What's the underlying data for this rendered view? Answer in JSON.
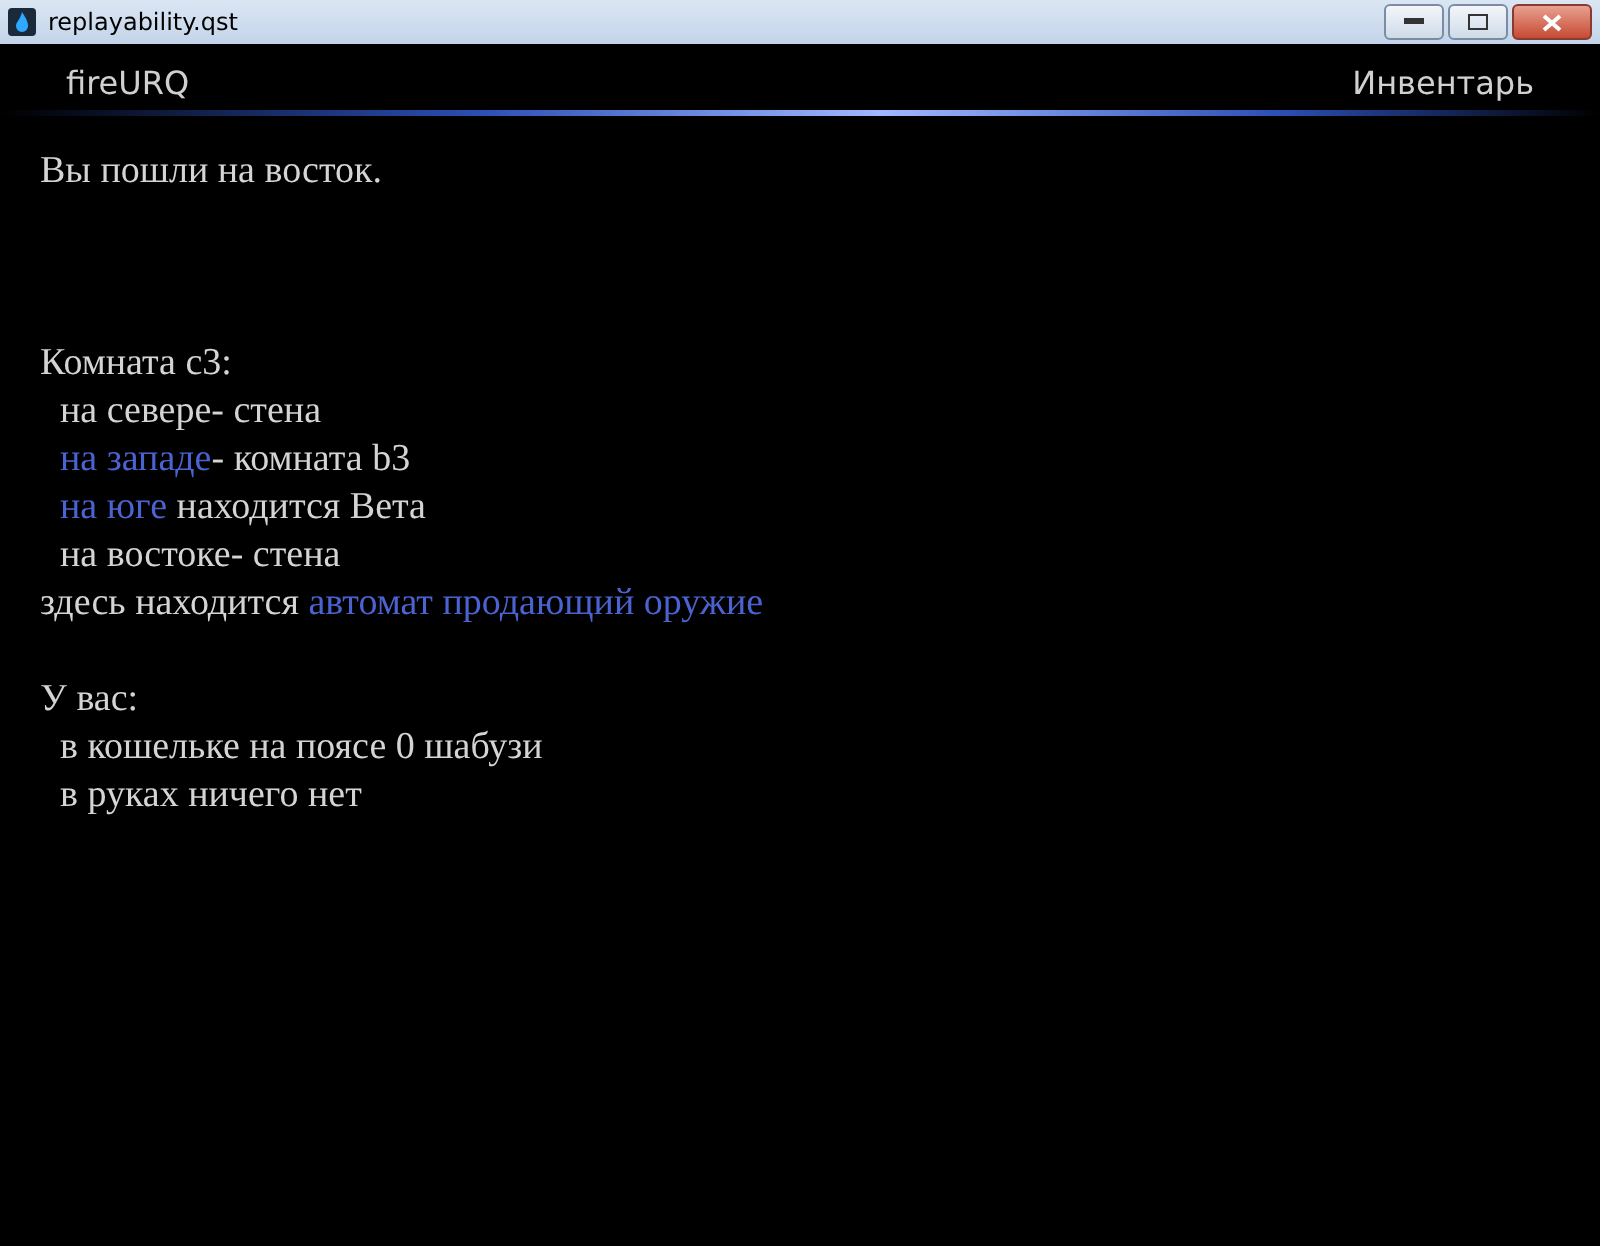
{
  "window": {
    "title": "replayability.qst"
  },
  "header": {
    "app_name": "fireURQ",
    "inventory": "Инвентарь"
  },
  "lines": [
    {
      "kind": "text",
      "indented": false,
      "parts": [
        {
          "kind": "text",
          "text": "Вы пошли на восток."
        }
      ]
    },
    {
      "kind": "blank"
    },
    {
      "kind": "blank"
    },
    {
      "kind": "blank"
    },
    {
      "kind": "text",
      "indented": false,
      "parts": [
        {
          "kind": "text",
          "text": "Комната c3:"
        }
      ]
    },
    {
      "kind": "text",
      "indented": true,
      "parts": [
        {
          "kind": "text",
          "text": "на севере- стена"
        }
      ]
    },
    {
      "kind": "text",
      "indented": true,
      "parts": [
        {
          "kind": "link",
          "text": "на западе"
        },
        {
          "kind": "text",
          "text": "- комната b3"
        }
      ]
    },
    {
      "kind": "text",
      "indented": true,
      "parts": [
        {
          "kind": "link",
          "text": "на юге"
        },
        {
          "kind": "text",
          "text": " находится Вета"
        }
      ]
    },
    {
      "kind": "text",
      "indented": true,
      "parts": [
        {
          "kind": "text",
          "text": "на востоке- стена"
        }
      ]
    },
    {
      "kind": "text",
      "indented": false,
      "parts": [
        {
          "kind": "text",
          "text": "здесь находится "
        },
        {
          "kind": "link",
          "text": "автомат продающий оружие"
        }
      ]
    },
    {
      "kind": "blank"
    },
    {
      "kind": "text",
      "indented": false,
      "parts": [
        {
          "kind": "text",
          "text": "У вас:"
        }
      ]
    },
    {
      "kind": "text",
      "indented": true,
      "parts": [
        {
          "kind": "text",
          "text": "в кошельке на поясе 0 шабузи"
        }
      ]
    },
    {
      "kind": "text",
      "indented": true,
      "parts": [
        {
          "kind": "text",
          "text": "в руках ничего нет"
        }
      ]
    }
  ]
}
